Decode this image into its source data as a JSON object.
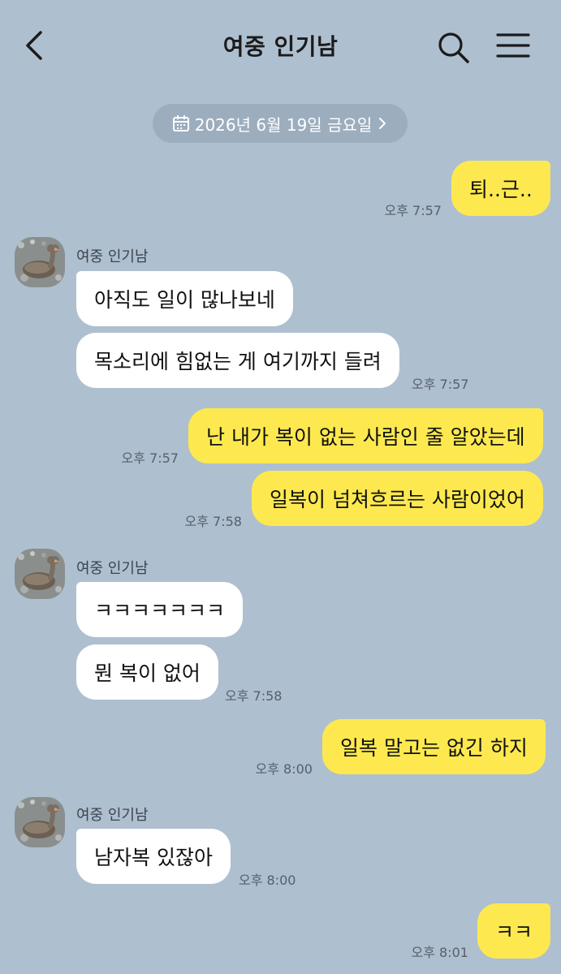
{
  "header": {
    "title": "여중 인기남",
    "back_icon": "chevron-left-icon",
    "search_icon": "search-icon",
    "menu_icon": "hamburger-menu-icon"
  },
  "date_pill": {
    "text": "2026년 6월 19일 금요일",
    "icon": "calendar-icon",
    "chevron": "chevron-right-icon"
  },
  "contact": {
    "name": "여중 인기남"
  },
  "colors": {
    "background": "#aebfd0",
    "my_bubble": "#fde94f",
    "their_bubble": "#ffffff",
    "date_pill": "#9cadbe"
  },
  "messages": [
    {
      "from": "me",
      "text": "퇴..근..",
      "time": "오후 7:57"
    },
    {
      "from": "them",
      "sender": "여중 인기남",
      "text": "아직도 일이 많나보네"
    },
    {
      "from": "them",
      "text": "목소리에 힘없는 게 여기까지 들려",
      "time": "오후 7:57"
    },
    {
      "from": "me",
      "text": "난 내가 복이 없는 사람인 줄 알았는데",
      "time": "오후 7:57"
    },
    {
      "from": "me",
      "text": "일복이 넘쳐흐르는 사람이었어",
      "time": "오후 7:58"
    },
    {
      "from": "them",
      "sender": "여중 인기남",
      "text": "ㅋㅋㅋㅋㅋㅋㅋ"
    },
    {
      "from": "them",
      "text": "뭔 복이 없어",
      "time": "오후 7:58"
    },
    {
      "from": "me",
      "text": "일복 말고는 없긴 하지",
      "time": "오후 8:00"
    },
    {
      "from": "them",
      "sender": "여중 인기남",
      "text": "남자복 있잖아",
      "time": "오후 8:00"
    },
    {
      "from": "me",
      "text": "ㅋㅋ",
      "time": "오후 8:01"
    }
  ]
}
